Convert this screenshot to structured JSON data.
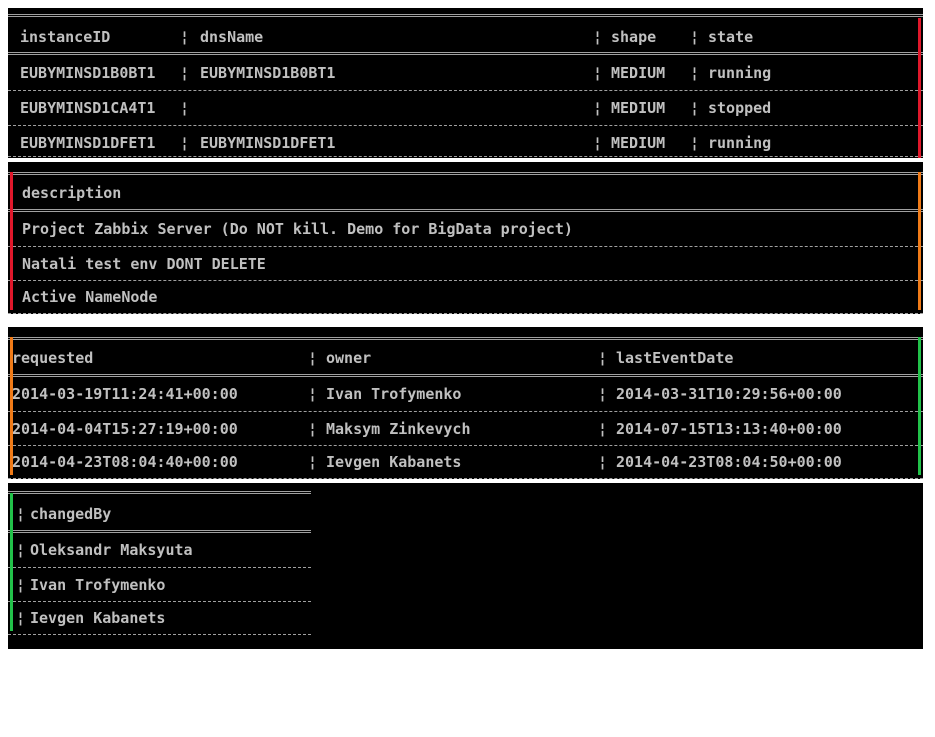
{
  "table1": {
    "headers": [
      "instanceID",
      "dnsName",
      "shape",
      "state"
    ],
    "rows": [
      [
        "EUBYMINSD1B0BT1",
        "EUBYMINSD1B0BT1",
        "MEDIUM",
        "running"
      ],
      [
        "EUBYMINSD1CA4T1",
        "",
        "MEDIUM",
        "stopped"
      ],
      [
        "EUBYMINSD1DFET1",
        "EUBYMINSD1DFET1",
        "MEDIUM",
        "running"
      ]
    ]
  },
  "table2": {
    "headers": [
      "description"
    ],
    "rows": [
      [
        "Project Zabbix Server (Do NOT kill. Demo for BigData project)"
      ],
      [
        "Natali test env DONT DELETE"
      ],
      [
        "Active NameNode"
      ]
    ]
  },
  "table3": {
    "headers": [
      "requested",
      "owner",
      "lastEventDate"
    ],
    "rows": [
      [
        "2014-03-19T11:24:41+00:00",
        "Ivan Trofymenko",
        "2014-03-31T10:29:56+00:00"
      ],
      [
        "2014-04-04T15:27:19+00:00",
        "Maksym Zinkevych",
        "2014-07-15T13:13:40+00:00"
      ],
      [
        "2014-04-23T08:04:40+00:00",
        "Ievgen Kabanets",
        "2014-04-23T08:04:50+00:00"
      ]
    ]
  },
  "table4": {
    "headers": [
      "changedBy"
    ],
    "rows": [
      [
        "Oleksandr Maksyuta"
      ],
      [
        "Ivan Trofymenko"
      ],
      [
        "Ievgen Kabanets"
      ]
    ]
  },
  "separator": "¦",
  "colors": {
    "background": "#000000",
    "text": "#c0c0c0",
    "marker_red": "#e0182b",
    "marker_orange": "#f07b18",
    "marker_green": "#22c24a"
  }
}
